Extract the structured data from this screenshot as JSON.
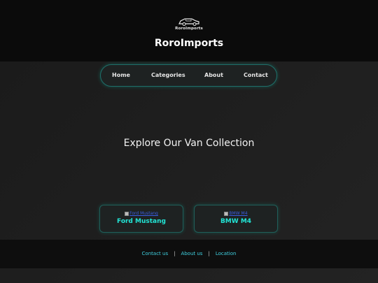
{
  "header": {
    "logo_text": "RoroImports",
    "brand": "RoroImports"
  },
  "nav": {
    "items": [
      {
        "label": "Home"
      },
      {
        "label": "Categories"
      },
      {
        "label": "About"
      },
      {
        "label": "Contact"
      }
    ]
  },
  "hero": {
    "heading": "Explore Our Van Collection"
  },
  "cards": [
    {
      "image_alt": "Ford Mustang",
      "title": "Ford Mustang"
    },
    {
      "image_alt": "BMW M4",
      "title": "BMW M4"
    }
  ],
  "footer": {
    "links": [
      {
        "label": "Contact us"
      },
      {
        "label": "About us"
      },
      {
        "label": "Location"
      }
    ],
    "separator": "|"
  },
  "colors": {
    "accent": "#22e5d6",
    "header_bg": "#0b0b0b",
    "footer_link": "#3fd0e0"
  }
}
